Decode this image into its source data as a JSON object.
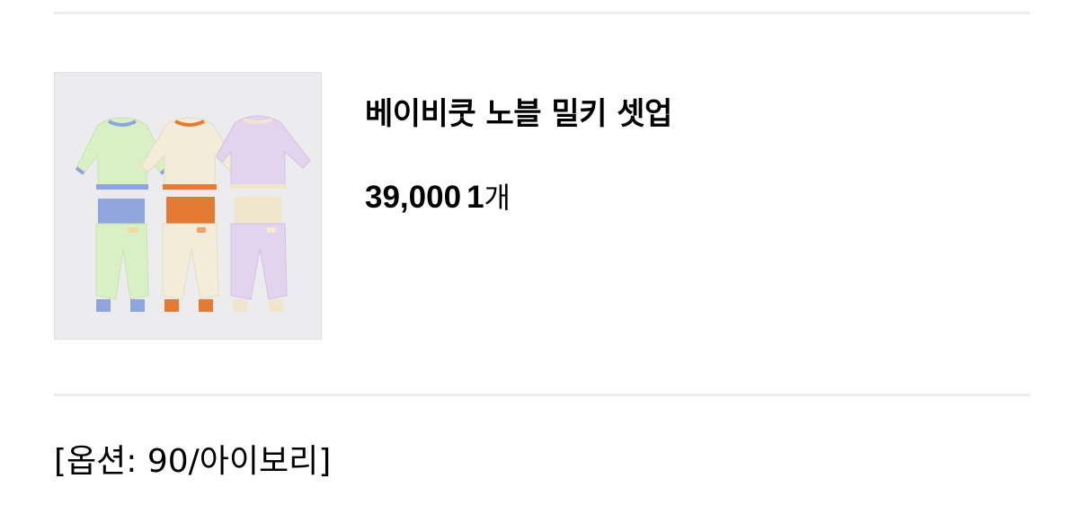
{
  "item": {
    "image_alt": "baby clothing set in green, ivory and lavender",
    "name": "베이비쿳 노블 밀키 셋업",
    "price": "39,000",
    "quantity": "1",
    "quantity_unit": "개",
    "option_text": "[옵션: 90/아이보리]"
  },
  "colors": {
    "divider": "#ececec",
    "image_bg": "#ececef",
    "set_green": "#d9f0c4",
    "set_ivory": "#f3ecd8",
    "set_lavender": "#e2d3ee",
    "trim_blue": "#8fa5dc",
    "trim_orange": "#e47a33",
    "trim_cream": "#efe6cc"
  }
}
